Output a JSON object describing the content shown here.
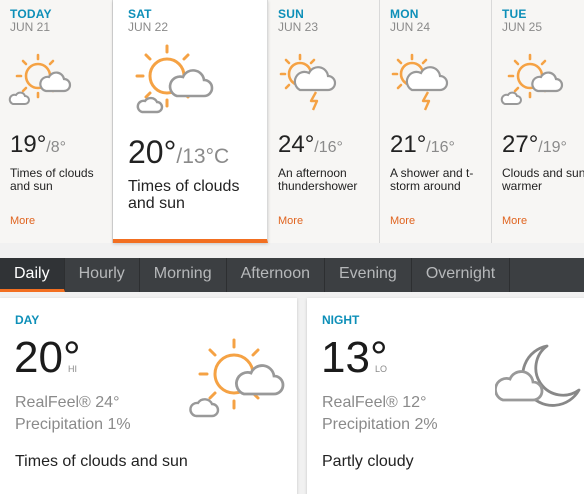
{
  "forecast": [
    {
      "dow": "TODAY",
      "date": "JUN 21",
      "hi": "19°",
      "lo": "/8°",
      "desc_line1": "Times of clouds",
      "desc_line2": "and sun",
      "more": "More",
      "icon": "partly-sunny-icon"
    },
    {
      "dow": "SAT",
      "date": "JUN 22",
      "hi": "20°",
      "lo": "/13°C",
      "desc_line1": "Times of clouds",
      "desc_line2": "and sun",
      "more": "More",
      "icon": "partly-sunny-icon"
    },
    {
      "dow": "SUN",
      "date": "JUN 23",
      "hi": "24°",
      "lo": "/16°",
      "desc_line1": "An afternoon",
      "desc_line2": "thundershower",
      "more": "More",
      "icon": "thunderstorm-sun-icon"
    },
    {
      "dow": "MON",
      "date": "JUN 24",
      "hi": "21°",
      "lo": "/16°",
      "desc_line1": "A shower and t-",
      "desc_line2": "storm around",
      "more": "More",
      "icon": "thunderstorm-sun-icon"
    },
    {
      "dow": "TUE",
      "date": "JUN 25",
      "hi": "27°",
      "lo": "/19°",
      "desc_line1": "Clouds and sun",
      "desc_line2": "warmer",
      "more": "More",
      "icon": "partly-sunny-icon"
    }
  ],
  "tabs": [
    "Daily",
    "Hourly",
    "Morning",
    "Afternoon",
    "Evening",
    "Overnight"
  ],
  "day": {
    "title": "DAY",
    "temp": "20°",
    "unit": "HI",
    "realfeel": "RealFeel® 24°",
    "precip": "Precipitation 1%",
    "desc": "Times of clouds and sun",
    "icon": "partly-sunny-icon"
  },
  "night": {
    "title": "NIGHT",
    "temp": "13°",
    "unit": "LO",
    "realfeel": "RealFeel® 12°",
    "precip": "Precipitation 2%",
    "desc": "Partly cloudy",
    "icon": "cloudy-moon-icon"
  },
  "colors": {
    "accent": "#f26f21",
    "title_blue": "#0d8fb8",
    "tab_bar": "#3c3f42",
    "sun": "#f5a244",
    "cloud": "#9a9a9a"
  }
}
